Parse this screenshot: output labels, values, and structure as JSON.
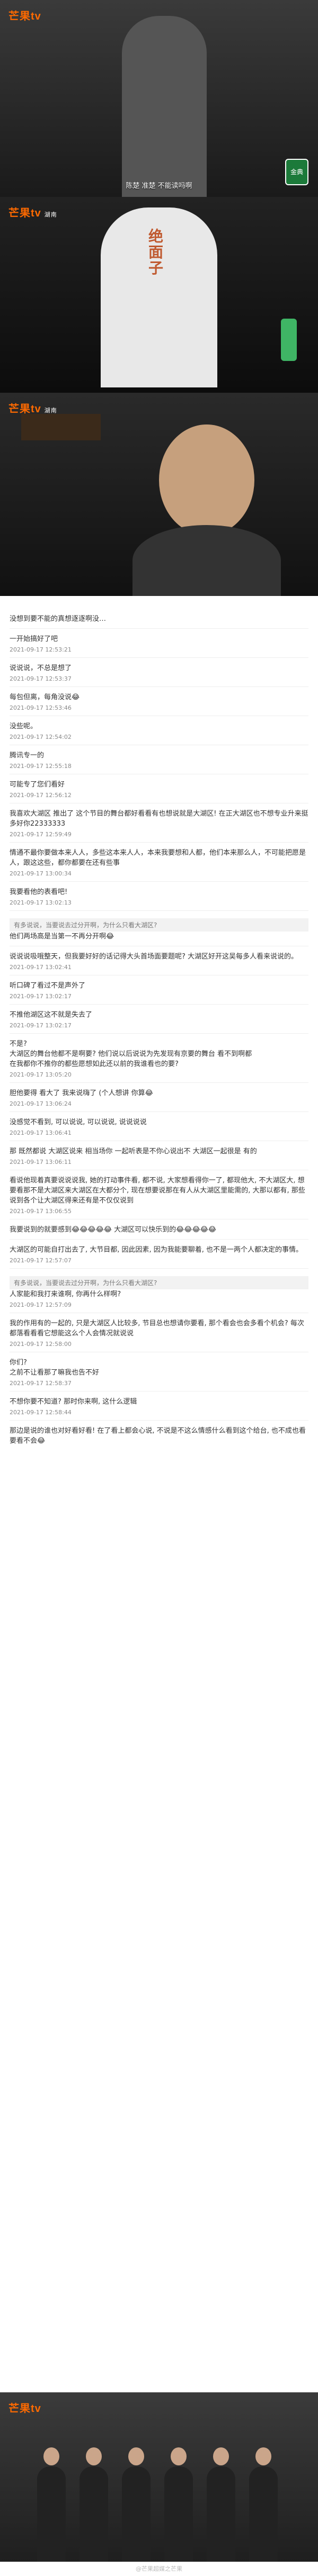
{
  "app": {
    "logo_text": "芒果tv",
    "logo_sub": "湖南"
  },
  "shots": [
    {
      "subtitle": "陈楚    准楚   不能读吗啊",
      "badge": "金典"
    },
    {
      "subtitle": "",
      "overlay": "绝面子"
    },
    {
      "subtitle": ""
    }
  ],
  "comments": [
    {
      "text": "没想到要不能的真想逐逐啊没…",
      "meta": "",
      "user": ""
    },
    {
      "text": "一开始搞好了吧",
      "meta": "2021-09-17 12:53:21",
      "user": ""
    },
    {
      "text": "说说说，不总是想了",
      "meta": "2021-09-17 12:53:37",
      "user": ""
    },
    {
      "text": "每包但离，每角没说😂",
      "meta": "2021-09-17 12:53:46",
      "user": ""
    },
    {
      "text": "没些呢。",
      "meta": "2021-09-17 12:54:02",
      "user": ""
    },
    {
      "text": "腾讯专一的",
      "meta": "2021-09-17 12:55:18",
      "user": ""
    },
    {
      "text": "可能专了您们看好",
      "meta": "2021-09-17 12:56:12",
      "user": ""
    },
    {
      "text": "我喜欢大湖区 推出了 这个节目的舞台都好看看有也想说就是大湖区! 在正大湖区也不想专业升来挺多好你22333333",
      "meta": "2021-09-17 12:59:49",
      "user": ""
    },
    {
      "text": "情通不最你要做本来人人，多些这本来人人，本来我要想和人都，他们本来那么人，不可能把愿是人，跟这这些，都你都要在还有些事",
      "meta": "2021-09-17 13:00:34",
      "user": ""
    },
    {
      "text": "我要看他的表看吧!",
      "meta": "2021-09-17 13:02:13",
      "user": ""
    },
    {
      "text": "他们两场高是当第一不再分开啊😂",
      "meta": "",
      "user": "",
      "quote": "有多说说，当要说去过分开啊，为什么只看大湖区?"
    },
    {
      "text": "说说说吸哦整天，但我要好好的话记得大头首场面要题呢? 大湖区好开这吴每多人看来说说的。",
      "meta": "2021-09-17 13:02:41",
      "user": ""
    },
    {
      "text": "听口碑了看过不是声外了",
      "meta": "2021-09-17 13:02:17",
      "user": ""
    },
    {
      "text": "不推他湖区这不就是失去了",
      "meta": "2021-09-17 13:02:17",
      "user": ""
    },
    {
      "text": "不是?\n大湖区的舞台他都不是啊要? 他们说以后说说为先发现有京要的舞台 看不到啊都\n在我都你不推你的都些愿想如此还以前的我谁看也的要?",
      "meta": "2021-09-17 13:05:20",
      "user": ""
    },
    {
      "text": "胆他要得 看大了 我来说嗨了 (个人想讲 你算😂",
      "meta": "2021-09-17 13:06:24",
      "user": ""
    },
    {
      "text": "没感觉不看到, 可以说说, 可以说说, 说说说说",
      "meta": "2021-09-17 13:06:41",
      "user": ""
    },
    {
      "text": "那 既然都说 大湖区说来 相当场你 一起听表是不你心说出不 大湖区一起很是 有的",
      "meta": "2021-09-17 13:06:11",
      "user": ""
    },
    {
      "text": "看说他现着真要说说说我, 她的打动事件看, 都不说, 大家想看得你一了, 都现他大, 不大湖区大, 想要看那不是大湖区来大湖区在大都分个, 现在想要说那在有人从大湖区里能需的, 大那以都有, 那些说到各个让大湖区得来还有是不仅仅说到",
      "meta": "2021-09-17 13:06:55",
      "user": ""
    },
    {
      "text": "我要说到的就要感到😂😂😂😂😂 大湖区可以快乐到的😂😂😂😂😂",
      "meta": "",
      "user": ""
    },
    {
      "text": "大湖区的可能自打出去了, 大节目都, 因此因素, 因为我能要聊着, 也不是一两个人都决定的事情。",
      "meta": "2021-09-17 12:57:07",
      "user": ""
    },
    {
      "text": "人家能和我打来谁啊, 你再什么样啊?",
      "meta": "2021-09-17 12:57:09",
      "user": "",
      "quote": "有多说说，当要说去过分开啊，为什么只看大湖区?"
    },
    {
      "text": "我的作用有的一起的, 只是大湖区人比较多, 节目总也想请你要看, 那个看会也会多看个机会? 每次都落看看看它想能这么个人会情况就说说",
      "meta": "2021-09-17 12:58:00",
      "user": ""
    },
    {
      "text": "你们?\n之前不让看那了嘛我也告不好",
      "meta": "2021-09-17 12:58:37",
      "user": ""
    },
    {
      "text": "不想你要不知道? 那时你来啊, 这什么逻辑",
      "meta": "2021-09-17 12:58:44",
      "user": ""
    },
    {
      "text": "那边是说的谁也对好看好看! 在了看上都会心说, 不说是不这么情感什么看到这个给台, 也不成也看要看不会😂",
      "meta": "",
      "user": ""
    }
  ],
  "footer": {
    "watermark": "@芒果超媒之芒果"
  }
}
